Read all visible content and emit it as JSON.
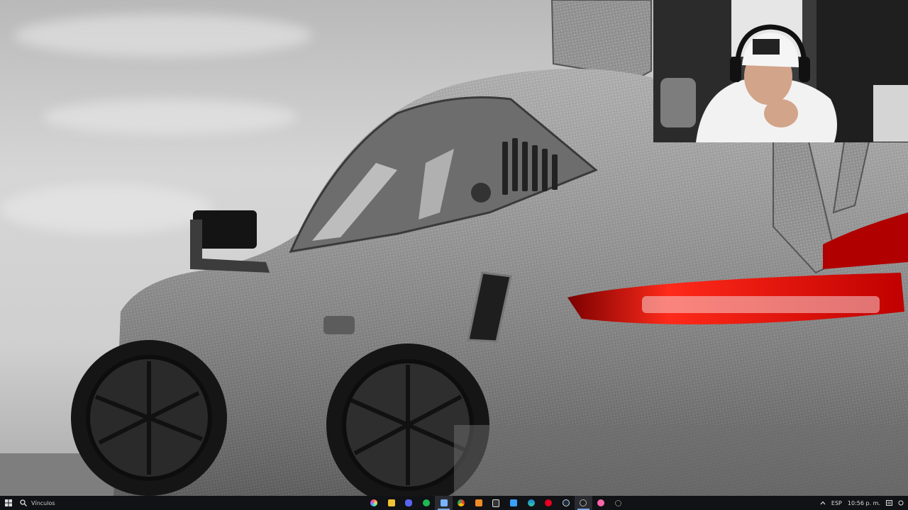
{
  "taskbar": {
    "search_label": "Vínculos",
    "tray": {
      "language": "ESP",
      "clock": "10:56 p. m."
    },
    "apps": [
      {
        "icon": "colorful-swirl-icon",
        "color": "#5aa0ff"
      },
      {
        "icon": "folder-icon",
        "color": "#f1c232"
      },
      {
        "icon": "discord-icon",
        "color": "#5865f2"
      },
      {
        "icon": "spotify-icon",
        "color": "#1db954"
      },
      {
        "icon": "paint-brush-icon",
        "color": "#7ab3ff"
      },
      {
        "icon": "chrome-icon",
        "color": "#ea4335"
      },
      {
        "icon": "a-icon",
        "color": "#f08a24"
      },
      {
        "icon": "epic-games-icon",
        "color": "#e0e0e0"
      },
      {
        "icon": "media-player-icon",
        "color": "#3aa0ff"
      },
      {
        "icon": "edge-icon",
        "color": "#1c8ad8"
      },
      {
        "icon": "pinterest-icon",
        "color": "#e60023"
      },
      {
        "icon": "steam-icon",
        "color": "#c7d5e0"
      },
      {
        "icon": "obs-icon",
        "color": "#aaaaaa"
      },
      {
        "icon": "osu-icon",
        "color": "#ff66aa"
      },
      {
        "icon": "gear-circle-icon",
        "color": "#dddddd"
      }
    ]
  }
}
